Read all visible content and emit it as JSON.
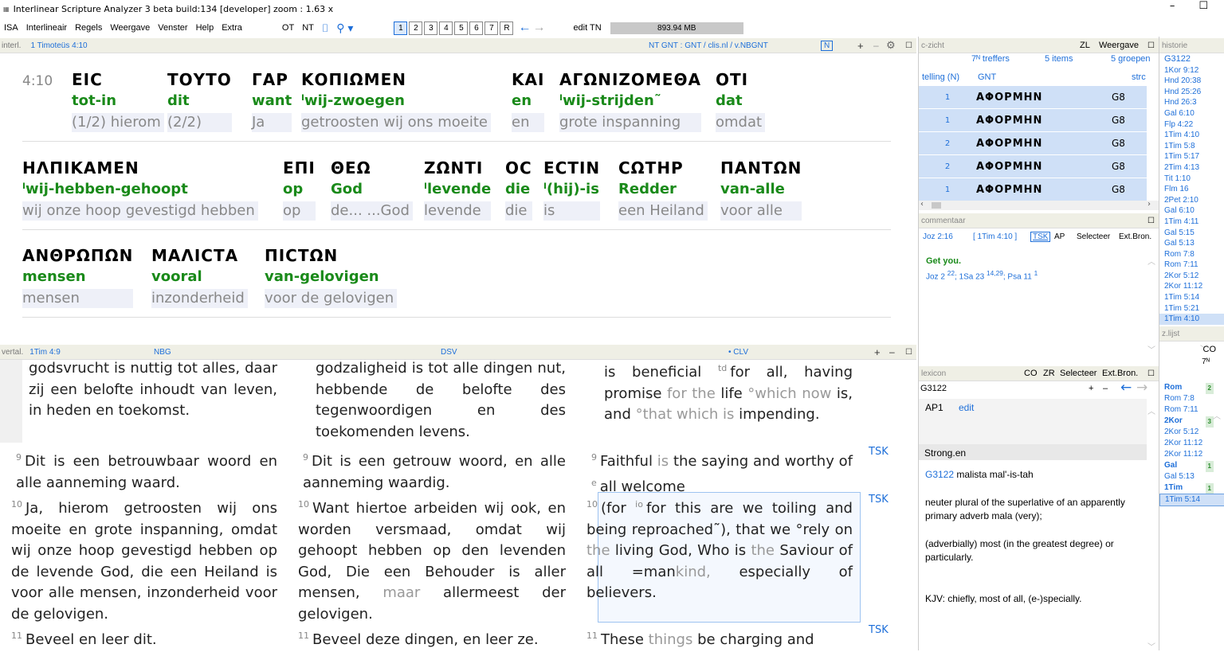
{
  "window": {
    "title": "Interlinear Scripture Analyzer 3 beta build:134  [developer]  zoom : 1.63 x",
    "minimize": "–",
    "maximize": "☐"
  },
  "menu": {
    "items": [
      "ISA",
      "Interlineair",
      "Regels",
      "Weergave",
      "Venster",
      "Help",
      "Extra"
    ],
    "ot": "OT",
    "nt": "NT",
    "pages": [
      "1",
      "2",
      "3",
      "4",
      "5",
      "6",
      "7",
      "R"
    ],
    "edit_tn": "edit TN",
    "memory": "893.94 MB"
  },
  "interlinear": {
    "header": {
      "label": "interl.",
      "ref": "1 Timoteüs 4:10",
      "sources": "NT GNT  :  GNT  /  clis.nl  /  v.NBGNT",
      "n_button": "N",
      "plus": "+",
      "minus": "–"
    },
    "verse_ref": "4:10",
    "row1": [
      {
        "gk": "ΕΙϹ",
        "gl": "tot-in",
        "tr": "(1/2) hierom"
      },
      {
        "gk": "ΤΟΥΤΟ",
        "gl": "dit",
        "tr": "(2/2)"
      },
      {
        "gk": "ΓΑΡ",
        "gl": "want",
        "tr": "Ja"
      },
      {
        "gk": "ΚΟΠΙΩΜΕΝ",
        "gl": "ˡwij-zwoegen",
        "tr": "getroosten wij ons moeite"
      },
      {
        "gk": "ΚΑΙ",
        "gl": "en",
        "tr": "en"
      },
      {
        "gk": "ΑΓΩΝΙΖΟΜΕΘΑ",
        "gl": "ˡwij-strijden˜",
        "tr": "grote inspanning"
      },
      {
        "gk": "ΟΤΙ",
        "gl": "dat",
        "tr": "omdat"
      }
    ],
    "row2": [
      {
        "gk": "ΗΛΠΙΚΑΜΕΝ",
        "gl": "ˡwij-hebben-gehoopt",
        "tr": "wij onze hoop gevestigd hebben"
      },
      {
        "gk": "ΕΠΙ",
        "gl": "op",
        "tr": "op"
      },
      {
        "gk": "ΘΕΩ",
        "gl": "God",
        "tr": "de... ...God"
      },
      {
        "gk": "ΖΩΝΤΙ",
        "gl": "ˡlevende",
        "tr": "levende"
      },
      {
        "gk": "ΟϹ",
        "gl": "die",
        "tr": "die"
      },
      {
        "gk": "ΕϹΤΙΝ",
        "gl": "ˡ(hij)-is",
        "tr": "is"
      },
      {
        "gk": "ϹΩΤΗΡ",
        "gl": "Redder",
        "tr": "een Heiland"
      },
      {
        "gk": "ΠΑΝΤΩΝ",
        "gl": "van-alle",
        "tr": "voor alle"
      }
    ],
    "row3": [
      {
        "gk": "ΑΝΘΡΩΠΩΝ",
        "gl": "mensen",
        "tr": "mensen"
      },
      {
        "gk": "ΜΑΛΙϹΤΑ",
        "gl": "vooral",
        "tr": "inzonderheid"
      },
      {
        "gk": "ΠΙϹΤΩΝ",
        "gl": "van-gelovigen",
        "tr": "voor de gelovigen"
      }
    ]
  },
  "vertal": {
    "header": {
      "label": "vertal.",
      "ref": "1Tim 4:9",
      "c1": "NBG",
      "c2": "DSV",
      "c3": "• CLV",
      "plus": "+",
      "minus": "–"
    },
    "col1": {
      "v8": "godsvrucht is nuttig tot alles, daar zij een belofte inhoudt van leven, in heden en toekomst.",
      "v9n": "9",
      "v9": "Dit is een betrouwbaar woord en alle aanneming waard.",
      "v10n": "10",
      "v10": "Ja, hierom getroosten wij ons moeite en grote inspanning, omdat wij onze hoop gevestigd hebben op de levende God, die een Heiland is voor alle mensen, inzonderheid voor de gelovigen.",
      "v11n": "11",
      "v11": "Beveel en leer dit."
    },
    "col2": {
      "v8": "godzaligheid is tot alle dingen nut, hebbende de belofte des tegenwoordigen en des toekomenden levens.",
      "v9n": "9",
      "v9": "Dit is een getrouw woord, en alle aanneming waardig.",
      "v10n": "10",
      "v10a": "Want hiertoe arbeiden wij ook, en worden versmaad, omdat wij gehoopt hebben op den levenden God, Die een Behouder is aller mensen,",
      "v10maar": "maar",
      "v10b": "allermeest der gelovigen.",
      "v11n": "11",
      "v11": "Beveel deze dingen, en leer ze."
    },
    "col3": {
      "v8a": "is beneficial",
      "v8sup": "td",
      "v8b": "for all, having",
      "v8c": "promise",
      "v8d": "for the",
      "v8e": "life",
      "v8f": "°which now",
      "v8g": "is,",
      "v8h": "and",
      "v8i": "°that which is",
      "v8j": "impending.",
      "v9n": "9",
      "v9a": "Faithful",
      "v9b": "is",
      "v9c": "the saying and worthy of",
      "v9sup": "e",
      "v9d": "all welcome",
      "v10n": "10",
      "v10a": "(for",
      "v10sup": "io",
      "v10b": "for this are we toiling and being reproached˜), that we",
      "v10c": "°rely on",
      "v10the": "the",
      "v10d": "living God, Who is",
      "v10the2": "the",
      "v10e": "Saviour of all",
      "v10f": "=man",
      "v10g": "kind,",
      "v10h": "especially of believers.",
      "v11n": "11",
      "v11a": "These",
      "v11b": "things",
      "v11c": "be charging and"
    },
    "tsk": "TSK"
  },
  "czicht": {
    "title": "c-zicht",
    "zl": "ZL",
    "weergave": "Weergave",
    "treffers": "7ᴺ treffers",
    "items": "5 items",
    "groepen": "5 groepen",
    "col_telling": "telling (N)",
    "col_gnt": "GNT",
    "col_str": "strc",
    "rows": [
      {
        "c": "1",
        "g": "ΑΦΟΡΜΗΝ",
        "s": "G8"
      },
      {
        "c": "1",
        "g": "ΑΦΟΡΜΗΝ",
        "s": "G8"
      },
      {
        "c": "2",
        "g": "ΑΦΟΡΜΗΝ",
        "s": "G8"
      },
      {
        "c": "2",
        "g": "ΑΦΟΡΜΗΝ",
        "s": "G8"
      },
      {
        "c": "1",
        "g": "ΑΦΟΡΜΗΝ",
        "s": "G8"
      }
    ]
  },
  "commentaar": {
    "title": "commentaar",
    "ref": "Joz 2:16",
    "ref2": "[ 1Tim 4:10 ]",
    "tsk": "TSK",
    "ap": "AP",
    "selecteer": "Selecteer",
    "extbron": "Ext.Bron.",
    "heading": "Get you.",
    "refs": "Joz 2",
    "r1": "22",
    "r1b": "; 1Sa 23",
    "r2": "14,29",
    "r2b": "; Psa 11",
    "r3": "1"
  },
  "lexicon": {
    "title": "lexicon",
    "co": "CO",
    "zr": "ZR",
    "selecteer": "Selecteer",
    "extbron": "Ext.Bron.",
    "input": "G3122",
    "plus": "+",
    "minus": "–",
    "ap1": "AP1",
    "edit": "edit",
    "strong": "Strong.en",
    "def_id": "G3122",
    "def_word": "malista mal'-is-tah",
    "def1": "neuter plural of the superlative of an apparently primary adverb mala (very);",
    "def2": "(adverbially) most (in the greatest degree) or particularly.",
    "def3": "KJV: chiefly, most of all, (e-)specially."
  },
  "historie": {
    "title": "historie",
    "top": "G3122",
    "items": [
      "1Kor 9:12",
      "Hnd 20:38",
      "Hnd 25:26",
      "Hnd 26:3",
      "Gal 6:10",
      "Flp 4:22",
      "1Tim 4:10",
      "1Tim 5:8",
      "1Tim 5:17",
      "2Tim 4:13",
      "Tit 1:10",
      "Flm 16",
      "2Pet 2:10",
      "Gal 6:10",
      "1Tim 4:11",
      "Gal 5:15",
      "Gal 5:13",
      "Rom 7:8",
      "Rom 7:11",
      "2Kor 5:12",
      "2Kor 11:12",
      "1Tim 5:14",
      "1Tim 5:21",
      "1Tim 4:10"
    ],
    "zlijst": "z.lijst",
    "co": "CO",
    "n7": "7ᴺ",
    "zitems": [
      {
        "t": "Rom",
        "b": true,
        "c": "2"
      },
      {
        "t": "Rom 7:8"
      },
      {
        "t": "Rom 7:11"
      },
      {
        "t": "2Kor",
        "b": true,
        "c": "3"
      },
      {
        "t": "2Kor 5:12"
      },
      {
        "t": "2Kor 11:12"
      },
      {
        "t": "2Kor 11:12"
      },
      {
        "t": "Gal",
        "b": true,
        "c": "1"
      },
      {
        "t": "Gal 5:13"
      },
      {
        "t": "1Tim",
        "b": true,
        "c": "1"
      },
      {
        "t": "1Tim 5:14"
      }
    ]
  }
}
